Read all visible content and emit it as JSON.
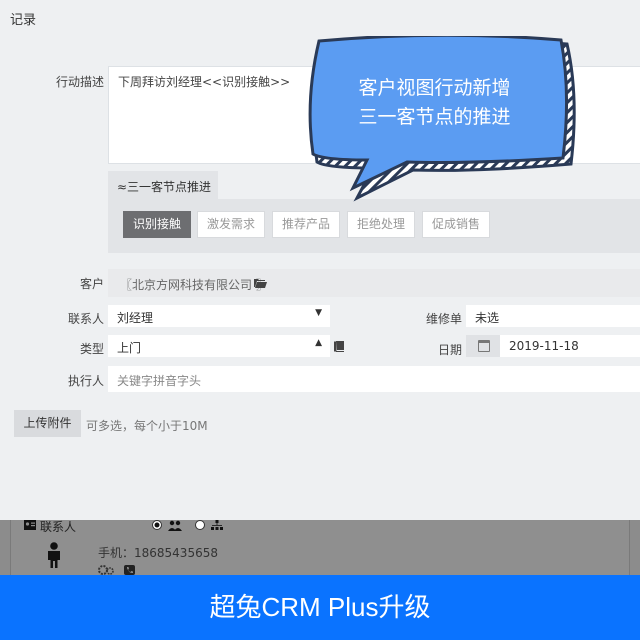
{
  "panel": {
    "title": "记录",
    "description_label": "行动描述",
    "description_value": "下周拜访刘经理<<识别接触>>",
    "stage_tab_label": "≈三一客节点推进",
    "stage_buttons": [
      "识别接触",
      "激发需求",
      "推荐产品",
      "拒绝处理",
      "促成销售"
    ],
    "customer_label": "客户",
    "customer_value": "〖北京方网科技有限公司 〗",
    "contact_label": "联系人",
    "contact_value": "刘经理",
    "type_label": "类型",
    "type_value": "上门",
    "executor_label": "执行人",
    "executor_placeholder": "关键字拼音字头",
    "repair_label": "维修单",
    "repair_value": "未选",
    "date_label": "日期",
    "date_value": "2019-11-18",
    "upload_label": "上传附件",
    "upload_hint": "可多选，每个小于10M"
  },
  "bubble": {
    "line1": "客户视图行动新增",
    "line2": "三一客节点的推进"
  },
  "background_card": {
    "contacts_label": "联系人",
    "phone": "手机：18685435658"
  },
  "footer": {
    "text": "超兔CRM Plus升级"
  },
  "colors": {
    "footer_bg": "#0a73ff",
    "bubble_fill": "#5b9cf2",
    "active_stage": "#6d6e71"
  }
}
